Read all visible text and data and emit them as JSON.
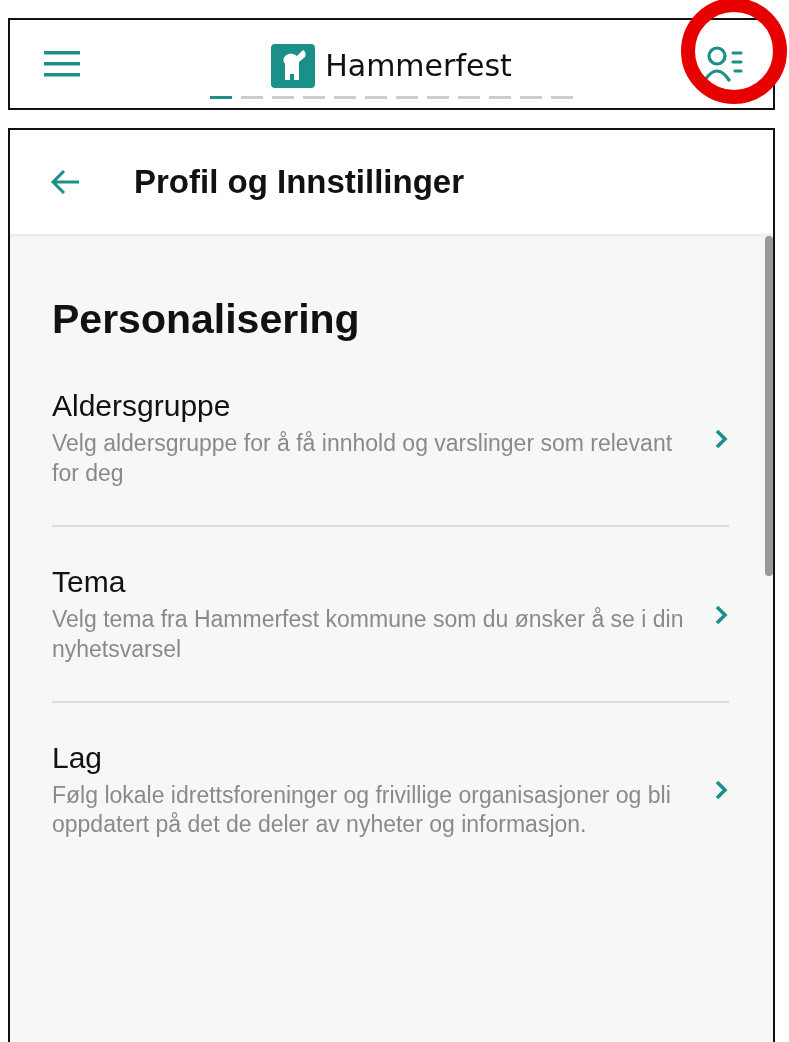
{
  "top_bar": {
    "brand": "Hammerfest",
    "profile_highlighted": true,
    "pages": [
      {
        "selected": true
      },
      {
        "selected": false
      },
      {
        "selected": false
      },
      {
        "selected": false
      },
      {
        "selected": false
      },
      {
        "selected": false
      },
      {
        "selected": false
      },
      {
        "selected": false
      },
      {
        "selected": false
      },
      {
        "selected": false
      },
      {
        "selected": false
      },
      {
        "selected": false
      }
    ]
  },
  "header": {
    "title": "Profil og Innstillinger"
  },
  "section": {
    "title": "Personalisering",
    "items": [
      {
        "title": "Aldersgruppe",
        "description": "Velg aldersgruppe for å få innhold og varslinger som relevant for deg"
      },
      {
        "title": "Tema",
        "description": "Velg tema fra Hammerfest kommune som du ønsker å se i din nyhetsvarsel"
      },
      {
        "title": "Lag",
        "description": "Følg lokale idrettsforeninger og frivillige organisasjoner og bli oppdatert på det de deler av nyheter og informasjon."
      }
    ]
  }
}
